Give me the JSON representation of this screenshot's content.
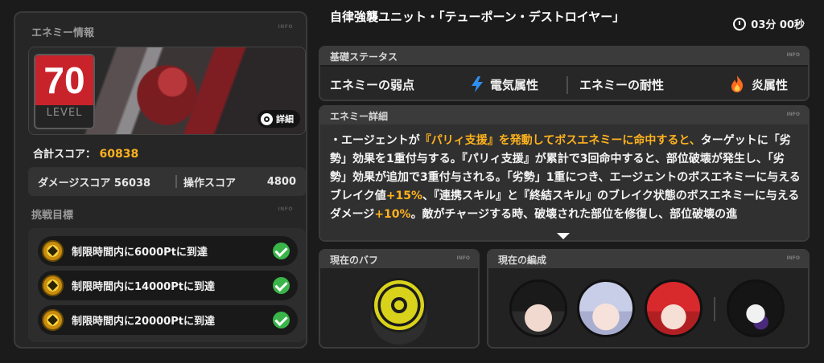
{
  "left": {
    "enemy_info_title": "エネミー情報",
    "info_tag": "INFO",
    "level": "70",
    "level_label": "LEVEL",
    "detail_button": "詳細",
    "total_score_label": "合計スコア：",
    "total_score_value": "60838",
    "damage_score": "ダメージスコア 56038",
    "operation_score_label": "操作スコア",
    "operation_score_value": "4800",
    "challenge_title": "挑戦目標",
    "goals": [
      {
        "label": "制限時間内に6000Ptに到達"
      },
      {
        "label": "制限時間内に14000Ptに到達"
      },
      {
        "label": "制限時間内に20000Ptに到達"
      }
    ]
  },
  "header": {
    "title": "自律強襲ユニット・「テューポーン・デストロイヤー」",
    "timer": "03分 00秒"
  },
  "basic_status": {
    "title": "基礎ステータス",
    "info_tag": "INFO",
    "weakness_label": "エネミーの弱点",
    "weakness_value": "電気属性",
    "resistance_label": "エネミーの耐性",
    "resistance_value": "炎属性"
  },
  "enemy_detail": {
    "title": "エネミー詳細",
    "info_tag": "INFO",
    "p1": "・エージェントが",
    "h1": "『パリィ支援』を発動してボスエネミーに命中すると、",
    "p2": "ターゲットに「劣勢」効果を1重付与する。『パリィ支援』が累計で3回命中すると、部位破壊が発生し、「劣勢」効果が追加で3重付与される。「劣勢」1重につき、エージェントのボスエネミーに与えるブレイク値",
    "h2": "+15%",
    "p3": "、『連携スキル』と『終結スキル』のブレイク状態のボスエネミーに与えるダメージ",
    "h3": "+10%",
    "p4": "。敵がチャージする時、破壊された部位を修復し、部位破壊の進"
  },
  "buff": {
    "title": "現在のバフ",
    "info_tag": "INFO"
  },
  "team": {
    "title": "現在の編成",
    "info_tag": "INFO"
  },
  "colors": {
    "accent": "#ffb21e",
    "level_red": "#c8232b",
    "check_green": "#39b54a",
    "buff_yellow": "#d9d21a",
    "electric_blue": "#2f8ff0",
    "fire_orange": "#ff6a1f"
  }
}
